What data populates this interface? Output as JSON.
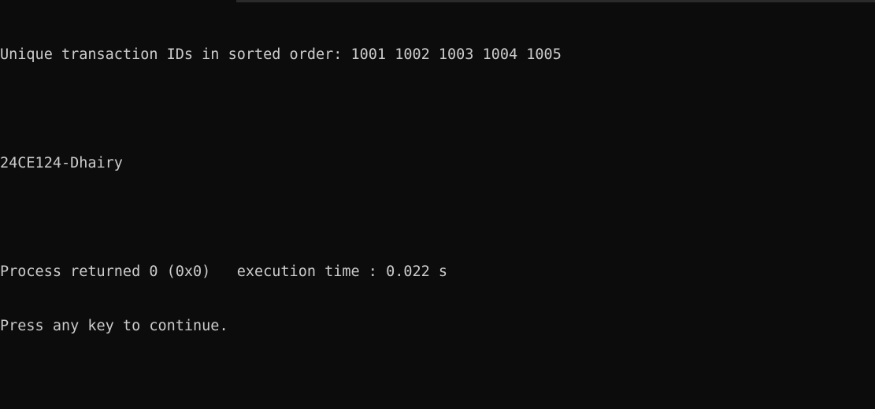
{
  "console": {
    "lines": [
      "Unique transaction IDs in sorted order: 1001 1002 1003 1004 1005",
      "",
      "24CE124-Dhairy",
      "",
      "Process returned 0 (0x0)   execution time : 0.022 s",
      "Press any key to continue."
    ]
  },
  "colors": {
    "background": "#0c0c0c",
    "text": "#cccccc"
  }
}
